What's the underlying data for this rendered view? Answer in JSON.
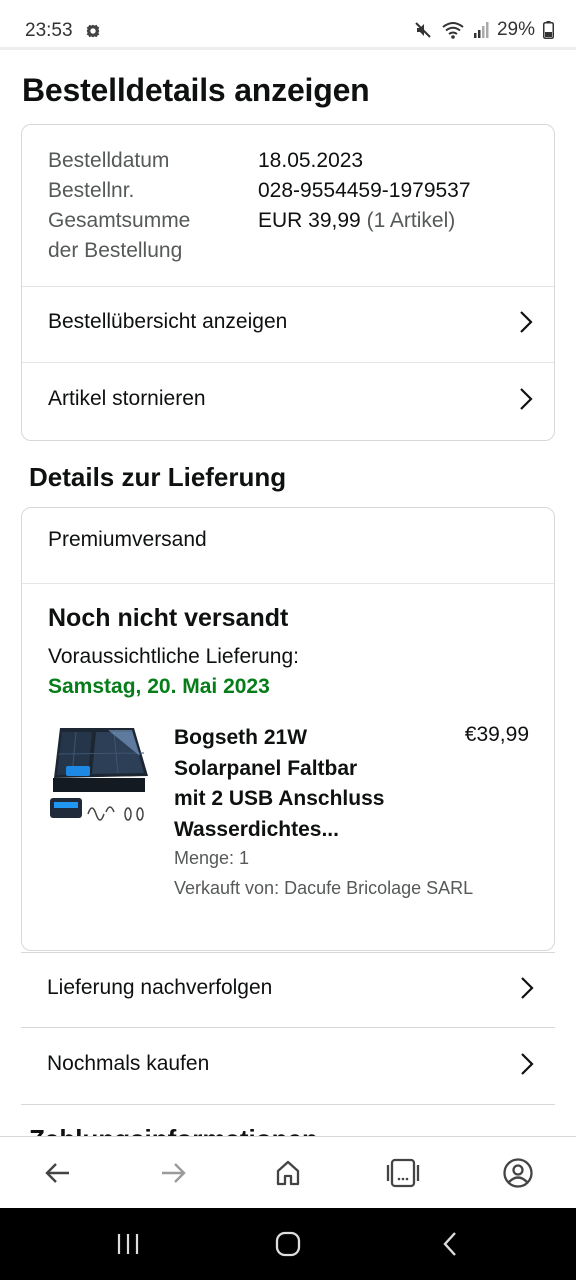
{
  "status_bar": {
    "time": "23:53",
    "battery": "29%",
    "icons": [
      "settings-gear-icon",
      "mute-icon",
      "wifi-icon",
      "signal-icon",
      "battery-icon"
    ]
  },
  "page": {
    "title": "Bestelldetails anzeigen"
  },
  "order": {
    "date_label": "Bestelldatum",
    "date_value": "18.05.2023",
    "number_label": "Bestellnr.",
    "number_value": "028-9554459-1979537",
    "total_label_1": "Gesamtsumme",
    "total_label_2": "der Bestellung",
    "total_value": "EUR 39,99",
    "total_items": "(1 Artikel)",
    "summary_link": "Bestellübersicht anzeigen",
    "cancel_link": "Artikel stornieren"
  },
  "delivery": {
    "section_title": "Details zur Lieferung",
    "shipping_method": "Premiumversand",
    "status": "Noch nicht versandt",
    "expected_label": "Voraussichtliche Lieferung:",
    "expected_date": "Samstag, 20. Mai 2023",
    "expected_date_color": "#067d18",
    "product": {
      "title_line1": "Bogseth 21W",
      "title_line2": "Solarpanel Faltbar",
      "title_line3": "mit 2 USB Anschluss",
      "title_line4": "Wasserdichtes...",
      "price": "€39,99",
      "quantity": "Menge: 1",
      "seller": "Verkauft von: Dacufe Bricolage SARL"
    }
  },
  "actions": {
    "track": "Lieferung nachverfolgen",
    "buy_again": "Nochmals kaufen"
  },
  "next_section_partial": "Zahlungsinformationen",
  "toolbar": {
    "icons": [
      "back-arrow-icon",
      "forward-arrow-icon",
      "home-icon",
      "tabs-icon",
      "account-icon"
    ],
    "tabs_count": "..."
  },
  "colors": {
    "text": "#0f1111",
    "muted": "#565959",
    "border": "#d5d9d9",
    "success_green": "#067d18"
  }
}
